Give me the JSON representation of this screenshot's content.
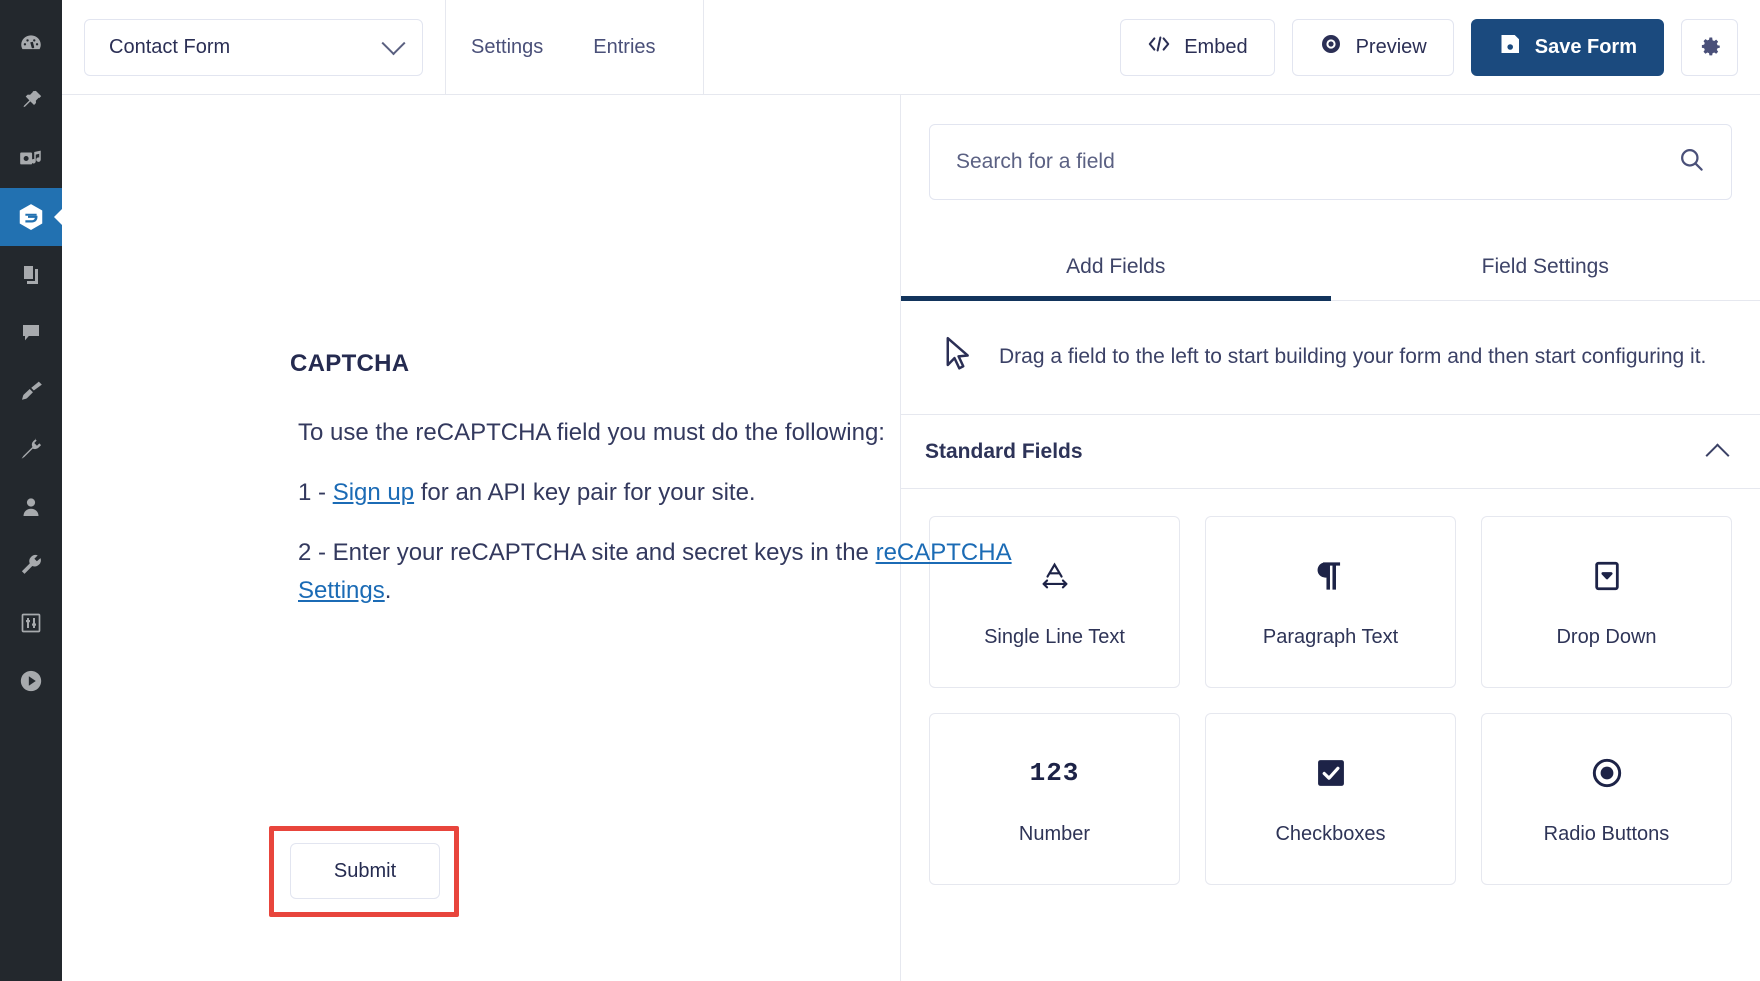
{
  "wp_sidebar": {
    "items": [
      {
        "name": "dashboard",
        "icon": "dashboard-icon",
        "active": false
      },
      {
        "name": "posts",
        "icon": "pin-icon",
        "active": false
      },
      {
        "name": "media",
        "icon": "media-icon",
        "active": false
      },
      {
        "name": "forms",
        "icon": "gravity-forms-icon",
        "active": true
      },
      {
        "name": "pages",
        "icon": "pages-icon",
        "active": false
      },
      {
        "name": "comments",
        "icon": "comment-icon",
        "active": false
      },
      {
        "name": "appearance",
        "icon": "paintbrush-icon",
        "active": false
      },
      {
        "name": "plugins",
        "icon": "plug-icon",
        "active": false
      },
      {
        "name": "users",
        "icon": "user-icon",
        "active": false
      },
      {
        "name": "tools",
        "icon": "wrench-icon",
        "active": false
      },
      {
        "name": "settings",
        "icon": "sliders-icon",
        "active": false
      },
      {
        "name": "media-player",
        "icon": "play-circle-icon",
        "active": false
      }
    ]
  },
  "topbar": {
    "form_selector": {
      "value": "Contact Form",
      "chevron_icon": "chevron-down-icon"
    },
    "nav_tabs": [
      {
        "label": "Settings"
      },
      {
        "label": "Entries"
      }
    ],
    "buttons": [
      {
        "label": "Embed",
        "icon": "code-icon",
        "style": "secondary"
      },
      {
        "label": "Preview",
        "icon": "eye-icon",
        "style": "secondary"
      },
      {
        "label": "Save Form",
        "icon": "floppy-disk-icon",
        "style": "primary"
      }
    ],
    "settings_button": {
      "icon": "gear-icon",
      "label": ""
    }
  },
  "canvas": {
    "captcha": {
      "title": "CAPTCHA",
      "intro": "To use the reCAPTCHA field you must do the following:",
      "step1_prefix": "1 - ",
      "step1_link": "Sign up",
      "step1_suffix": " for an API key pair for your site.",
      "step2_prefix": "2 - Enter your reCAPTCHA site and secret keys in the ",
      "step2_link": "reCAPTCHA Settings",
      "step2_suffix": "."
    },
    "submit_button": {
      "label": "Submit",
      "highlight_color": "#e8453c"
    }
  },
  "right_panel": {
    "search": {
      "placeholder": "Search for a field",
      "value": "",
      "icon": "search-icon"
    },
    "tabs": [
      {
        "label": "Add Fields",
        "active": true
      },
      {
        "label": "Field Settings",
        "active": false
      }
    ],
    "drag_hint": {
      "icon": "cursor-arrow-icon",
      "text": "Drag a field to the left to start building your form and then start configuring it."
    },
    "sections": [
      {
        "title": "Standard Fields",
        "collapse_icon": "chevron-up-icon",
        "fields": [
          {
            "label": "Single Line Text",
            "icon": "single-line-text-icon"
          },
          {
            "label": "Paragraph Text",
            "icon": "paragraph-icon"
          },
          {
            "label": "Drop Down",
            "icon": "drop-down-icon"
          },
          {
            "label": "Number",
            "icon": "number-123-icon"
          },
          {
            "label": "Checkboxes",
            "icon": "checkbox-icon"
          },
          {
            "label": "Radio Buttons",
            "icon": "radio-button-icon"
          }
        ]
      }
    ]
  },
  "colors": {
    "sidebar_bg": "#23282d",
    "sidebar_active": "#2271b1",
    "primary_button": "#1b4a7e",
    "link": "#1b6bb5",
    "highlight": "#e8453c",
    "text": "#2b2f55"
  }
}
